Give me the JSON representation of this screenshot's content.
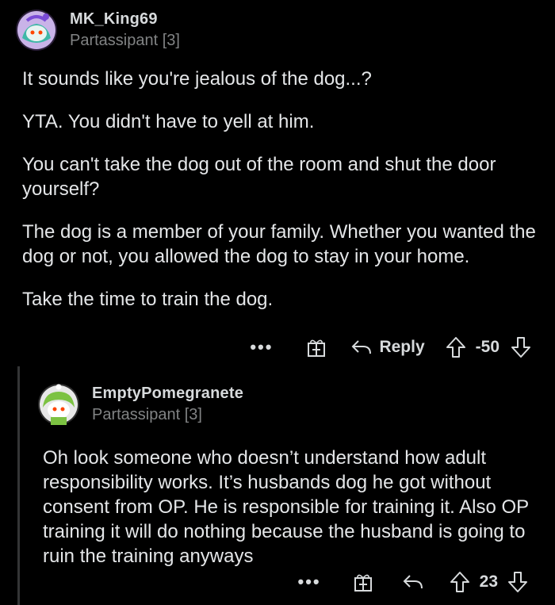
{
  "comment1": {
    "username": "MK_King69",
    "flair": "Partassipant [3]",
    "paragraphs": [
      "It sounds like you're jealous of the dog...?",
      "YTA. You didn't have to yell at him.",
      "You can't take the dog out of the room and shut the door yourself?",
      "The dog is a member of your family. Whether you wanted the dog or not, you allowed the dog to stay in your home.",
      "Take the time to train the dog."
    ],
    "more": "•••",
    "reply_label": "Reply",
    "score": "-50"
  },
  "comment2": {
    "username": "EmptyPomegranete",
    "flair": "Partassipant [3]",
    "paragraphs": [
      "Oh look someone who doesn’t understand how adult responsibility works. It’s husbands dog he got without consent from OP. He is responsible for training it. Also OP training it will do nothing because the husband is going to ruin the training anyways"
    ],
    "more": "•••",
    "score": "23"
  },
  "colors": {
    "background": "#000000",
    "text": "#d7dadc",
    "muted": "#818384",
    "thread": "#343536"
  },
  "icons": [
    "avatar",
    "gift-icon",
    "reply-arrow-icon",
    "upvote-icon",
    "downvote-icon",
    "more-icon"
  ]
}
